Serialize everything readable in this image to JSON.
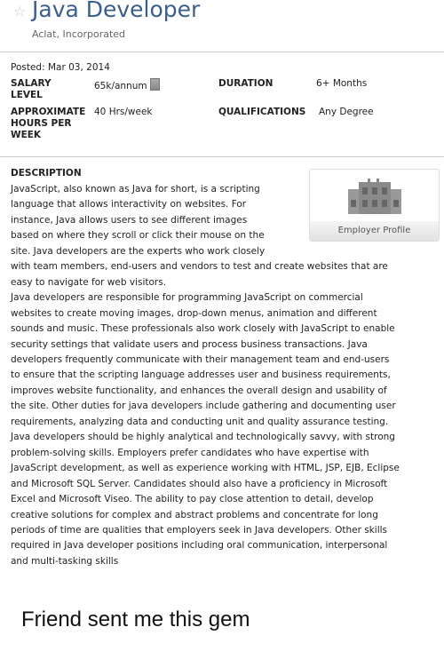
{
  "job": {
    "title": "Java Developer",
    "company": "Aclat, Incorporated",
    "posted": "Posted: Mar 03, 2014"
  },
  "fields": {
    "salary_label": "SALARY LEVEL",
    "salary_value": "65k/annum",
    "duration_label": "DURATION",
    "duration_value": "6+ Months",
    "hours_label": "APPROXIMATE HOURS PER WEEK",
    "hours_value": "40 Hrs/week",
    "qual_label": "QUALIFICATIONS",
    "qual_value": "Any Degree"
  },
  "description": {
    "heading": "DESCRIPTION",
    "lines": [
      "JavaScript, also known as Java for short, is a scripting",
      "language that allows interactivity on websites. For",
      "instance, Java allows users to see different images",
      "based on where they scroll or click their mouse on the",
      "site. Java developers are the experts who work closely",
      "with team members, end-users and vendors to test and create websites that are",
      "easy to navigate for web visitors.",
      "Java developers are responsible for programming JavaScript on commercial",
      "websites to create moving images, drop-down menus, animation and different",
      "sounds and music. These professionals also work closely with JavaScript to enable",
      "security settings that validate users and process business transactions. Java",
      "developers frequently communicate with their management team and end-users",
      "to ensure that the scripting language addresses user and business requirements,",
      "improves website functionality, and enhances the overall design and usability of",
      "the site. Other duties for java developers include gathering and documenting user",
      "requirements, analyzing data and conducting unit and quality assurance testing.",
      "Java developers should be highly analytical and technologically savvy, with strong",
      "problem-solving skills. Employers prefer candidates who have expertise with",
      "JavaScript development, as well as experience working with HTML, JSP, EJB, Eclipse",
      "and Microsoft SQL Server. Candidates should also have a proficiency in Microsoft",
      "Excel and Microsoft Viseo. The ability to pay close attention to detail, develop",
      "creative solutions for complex and abstract problems and concentrate for long",
      "periods of time are qualities that employers seek in Java developers. Other skills",
      "required in Java developer positions including oral communication, interpersonal",
      "and multi-tasking skills"
    ]
  },
  "employer_profile": "Employer Profile",
  "caption": "Friend sent me this gem"
}
